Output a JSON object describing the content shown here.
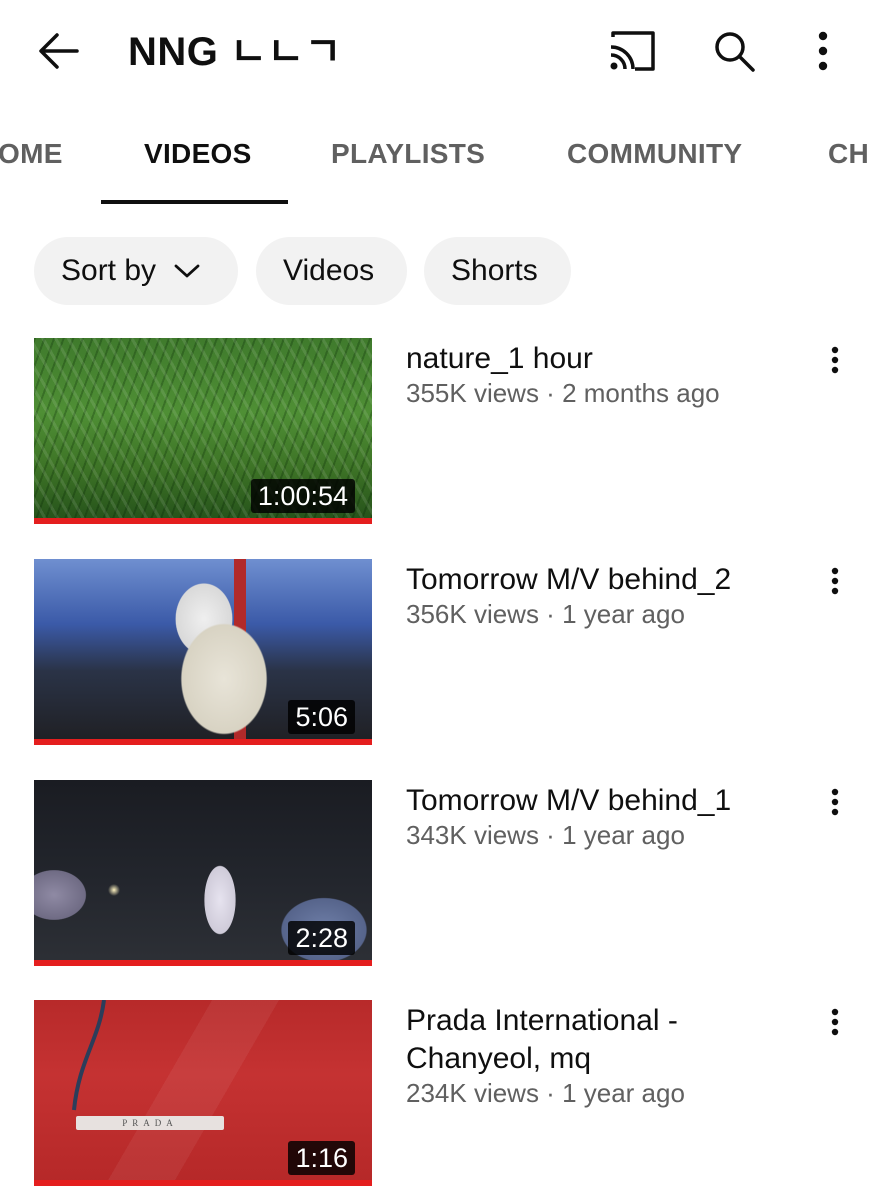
{
  "header": {
    "back_icon": "arrow-left-icon",
    "channel_name": "NNG ㄴㄴㄱ",
    "cast_icon": "cast-icon",
    "search_icon": "search-icon",
    "more_icon": "more-vertical-icon"
  },
  "tabs": [
    {
      "label": "HOME",
      "visible_text": "OME",
      "active": false
    },
    {
      "label": "VIDEOS",
      "visible_text": "VIDEOS",
      "active": true
    },
    {
      "label": "PLAYLISTS",
      "visible_text": "PLAYLISTS",
      "active": false
    },
    {
      "label": "COMMUNITY",
      "visible_text": "COMMUNITY",
      "active": false
    },
    {
      "label": "CHANNELS",
      "visible_text": "CH",
      "active": false
    }
  ],
  "chips": {
    "sort_label": "Sort by",
    "videos_label": "Videos",
    "shorts_label": "Shorts"
  },
  "videos": [
    {
      "title": "nature_1 hour",
      "subtitle": "355K views · 2 months ago",
      "duration": "1:00:54",
      "watched": true
    },
    {
      "title": "Tomorrow M/V behind_2",
      "subtitle": "356K views · 1 year ago",
      "duration": "5:06",
      "watched": true
    },
    {
      "title": "Tomorrow M/V behind_1",
      "subtitle": "343K views · 1 year ago",
      "duration": "2:28",
      "watched": true
    },
    {
      "title": "Prada International  -\nChanyeol, mq",
      "subtitle": "234K views · 1 year ago",
      "duration": "1:16",
      "watched": true,
      "thumb_text": "PRADA"
    }
  ],
  "colors": {
    "progress_red": "#e41e1e",
    "text_primary": "#0f0f0f",
    "text_secondary": "#606060",
    "chip_bg": "#f2f2f2"
  }
}
